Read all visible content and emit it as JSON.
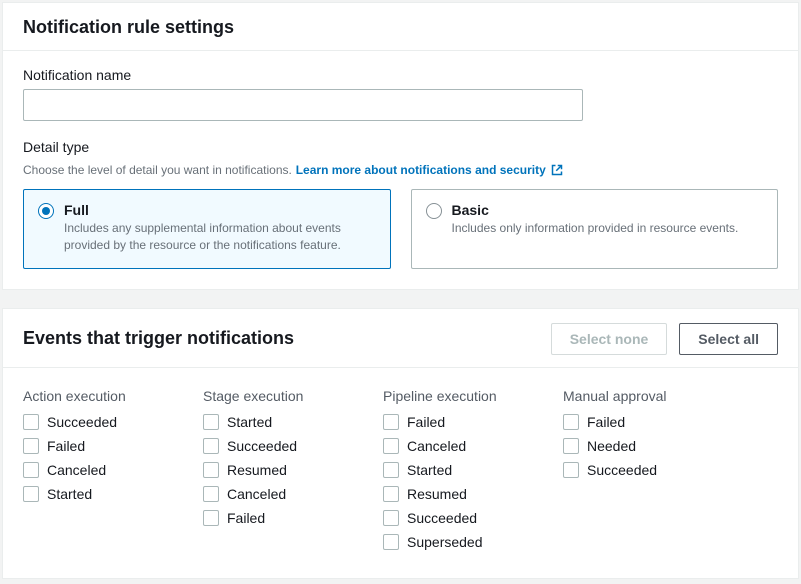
{
  "settings": {
    "title": "Notification rule settings",
    "nameLabel": "Notification name",
    "nameValue": "",
    "detail": {
      "label": "Detail type",
      "hint": "Choose the level of detail you want in notifications.",
      "learnMore": "Learn more about notifications and security",
      "options": [
        {
          "id": "full",
          "title": "Full",
          "desc": "Includes any supplemental information about events provided by the resource or the notifications feature.",
          "selected": true
        },
        {
          "id": "basic",
          "title": "Basic",
          "desc": "Includes only information provided in resource events.",
          "selected": false
        }
      ]
    }
  },
  "events": {
    "title": "Events that trigger notifications",
    "selectNone": "Select none",
    "selectAll": "Select all",
    "columns": [
      {
        "title": "Action execution",
        "items": [
          "Succeeded",
          "Failed",
          "Canceled",
          "Started"
        ]
      },
      {
        "title": "Stage execution",
        "items": [
          "Started",
          "Succeeded",
          "Resumed",
          "Canceled",
          "Failed"
        ]
      },
      {
        "title": "Pipeline execution",
        "items": [
          "Failed",
          "Canceled",
          "Started",
          "Resumed",
          "Succeeded",
          "Superseded"
        ]
      },
      {
        "title": "Manual approval",
        "items": [
          "Failed",
          "Needed",
          "Succeeded"
        ]
      }
    ]
  }
}
